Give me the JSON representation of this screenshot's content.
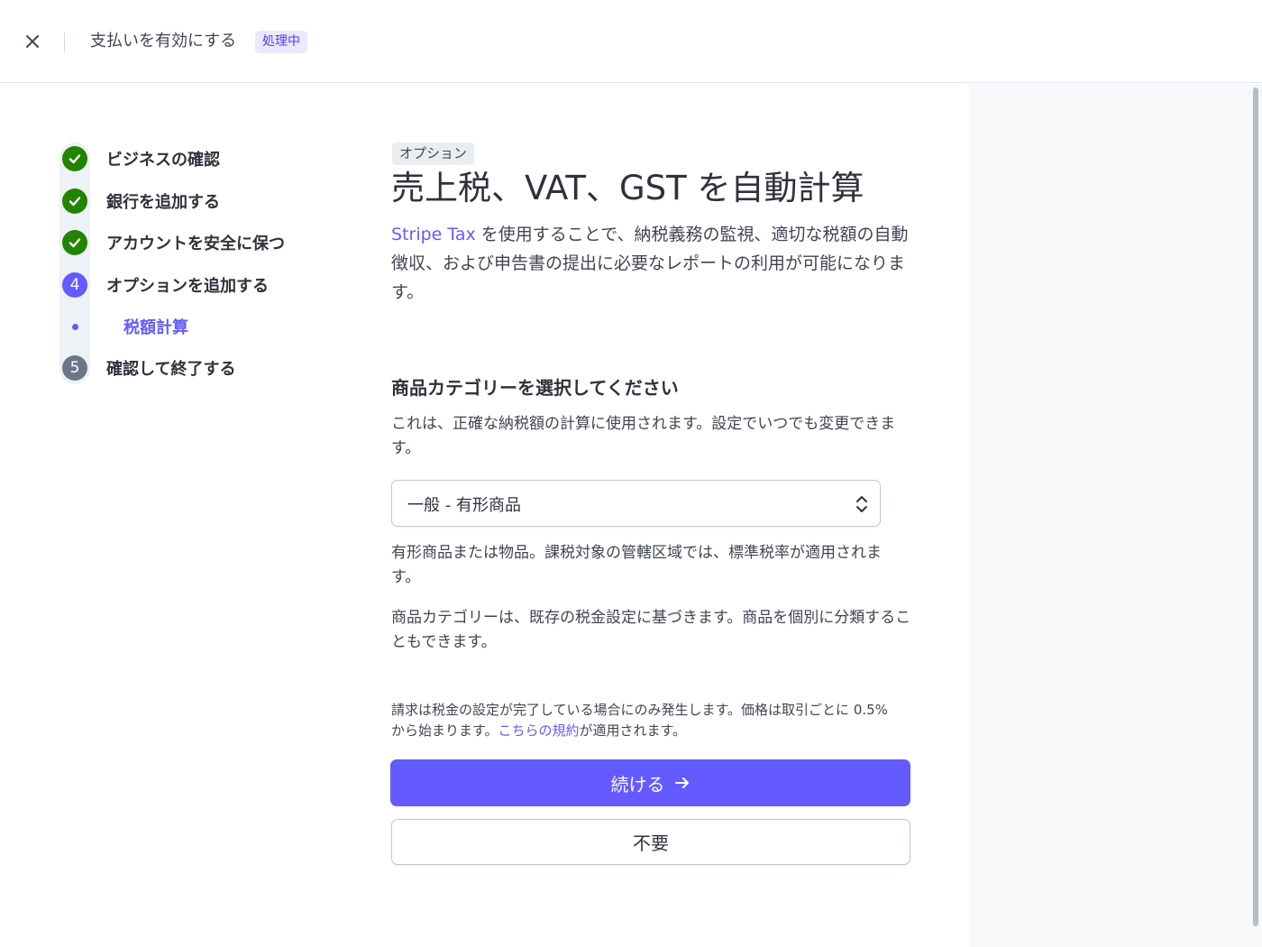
{
  "header": {
    "title": "支払いを有効にする",
    "status_badge": "処理中",
    "close_icon": "close-icon"
  },
  "stepper": {
    "steps": [
      {
        "label": "ビジネスの確認",
        "state": "done",
        "icon": "check-icon"
      },
      {
        "label": "銀行を追加する",
        "state": "done",
        "icon": "check-icon"
      },
      {
        "label": "アカウントを安全に保つ",
        "state": "done",
        "icon": "check-icon"
      },
      {
        "label": "オプションを追加する",
        "state": "active",
        "number": "4"
      },
      {
        "label": "確認して終了する",
        "state": "pending",
        "number": "5"
      }
    ],
    "substep": {
      "label": "税額計算",
      "state": "active"
    }
  },
  "main": {
    "tag": "オプション",
    "title": "売上税、VAT、GST を自動計算",
    "intro_link": "Stripe Tax",
    "intro_text": " を使用することで、納税義務の監視、適切な税額の自動徴収、および申告書の提出に必要なレポートの利用が可能になります。",
    "category_title": "商品カテゴリーを選択してください",
    "category_desc": "これは、正確な納税額の計算に使用されます。設定でいつでも変更できます。",
    "select_value": "一般 - 有形商品",
    "select_help": "有形商品または物品。課税対象の管轄区域では、標準税率が適用されます。",
    "category_note": "商品カテゴリーは、既存の税金設定に基づきます。商品を個別に分類することもできます。",
    "terms_text_before": "請求は税金の設定が完了している場合にのみ発生します。価格は取引ごとに 0.5% から始まります。",
    "terms_link": "こちらの規約",
    "terms_text_after": "が適用されます。",
    "continue_label": "続ける",
    "skip_label": "不要"
  },
  "colors": {
    "accent": "#635bff",
    "done": "#228403",
    "pending": "#6c7688",
    "badge_bg": "#ede7ff"
  }
}
